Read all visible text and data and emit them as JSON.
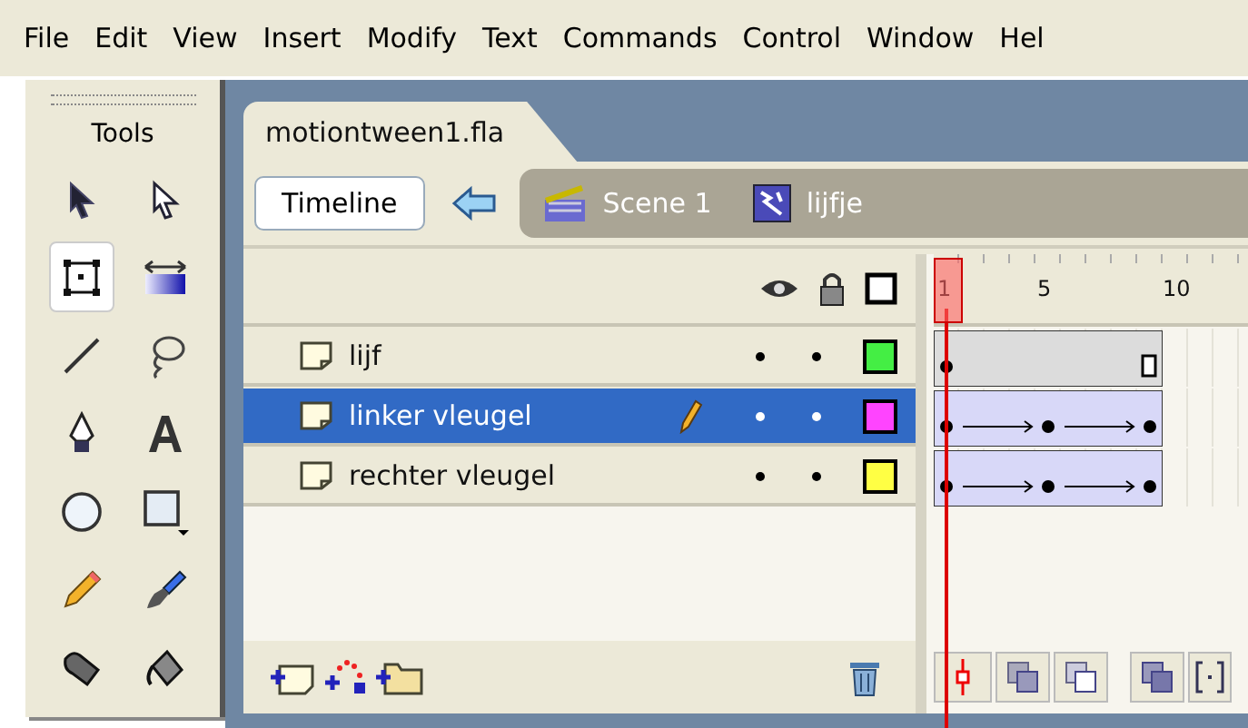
{
  "menu": [
    "File",
    "Edit",
    "View",
    "Insert",
    "Modify",
    "Text",
    "Commands",
    "Control",
    "Window",
    "Hel"
  ],
  "tools": {
    "title": "Tools",
    "items": [
      {
        "kind": "arrow",
        "selected": false
      },
      {
        "kind": "subselect",
        "selected": false
      },
      {
        "kind": "transform",
        "selected": true
      },
      {
        "kind": "gradient",
        "selected": false
      },
      {
        "kind": "line",
        "selected": false
      },
      {
        "kind": "lasso",
        "selected": false
      },
      {
        "kind": "pen",
        "selected": false
      },
      {
        "kind": "text",
        "selected": false
      },
      {
        "kind": "oval",
        "selected": false
      },
      {
        "kind": "rect",
        "selected": false
      },
      {
        "kind": "pencil",
        "selected": false
      },
      {
        "kind": "brush",
        "selected": false
      },
      {
        "kind": "ink",
        "selected": false
      },
      {
        "kind": "bucket",
        "selected": false
      }
    ]
  },
  "document_tab": "motiontween1.fla",
  "toolbar": {
    "timeline_button": "Timeline",
    "scene": "Scene 1",
    "symbol": "lijfje"
  },
  "ruler": [
    "1",
    "5",
    "10"
  ],
  "layers": [
    {
      "name": "lijf",
      "selected": false,
      "color": "#44ee44",
      "tween": false
    },
    {
      "name": "linker vleugel",
      "selected": true,
      "color": "#ff44ff",
      "tween": true
    },
    {
      "name": "rechter vleugel",
      "selected": false,
      "color": "#ffff44",
      "tween": true
    }
  ]
}
